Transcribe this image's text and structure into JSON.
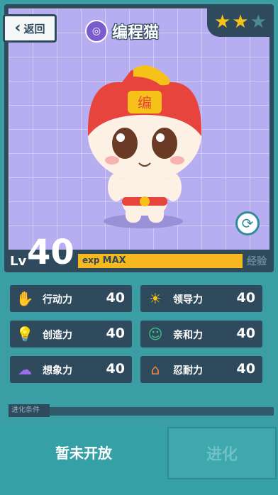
{
  "header": {
    "back_label": "返回",
    "title": "编程猫"
  },
  "stars": {
    "filled": 2,
    "total": 3
  },
  "level": {
    "prefix": "Lv",
    "value": "40"
  },
  "exp": {
    "prefix": "exp",
    "status": "MAX",
    "tag": "经验"
  },
  "stats": [
    {
      "name": "行动力",
      "value": "40",
      "icon": "action-icon"
    },
    {
      "name": "领导力",
      "value": "40",
      "icon": "leadership-icon"
    },
    {
      "name": "创造力",
      "value": "40",
      "icon": "creativity-icon"
    },
    {
      "name": "亲和力",
      "value": "40",
      "icon": "affinity-icon"
    },
    {
      "name": "想象力",
      "value": "40",
      "icon": "imagination-icon"
    },
    {
      "name": "忍耐力",
      "value": "40",
      "icon": "endurance-icon"
    }
  ],
  "evolution": {
    "section_label": "进化条件",
    "status": "暂未开放",
    "button_label": "进化"
  },
  "colors": {
    "panel": "#2f4a5c",
    "teal": "#3a9ea4",
    "stage": "#b7aef2",
    "exp": "#f6b81c"
  }
}
